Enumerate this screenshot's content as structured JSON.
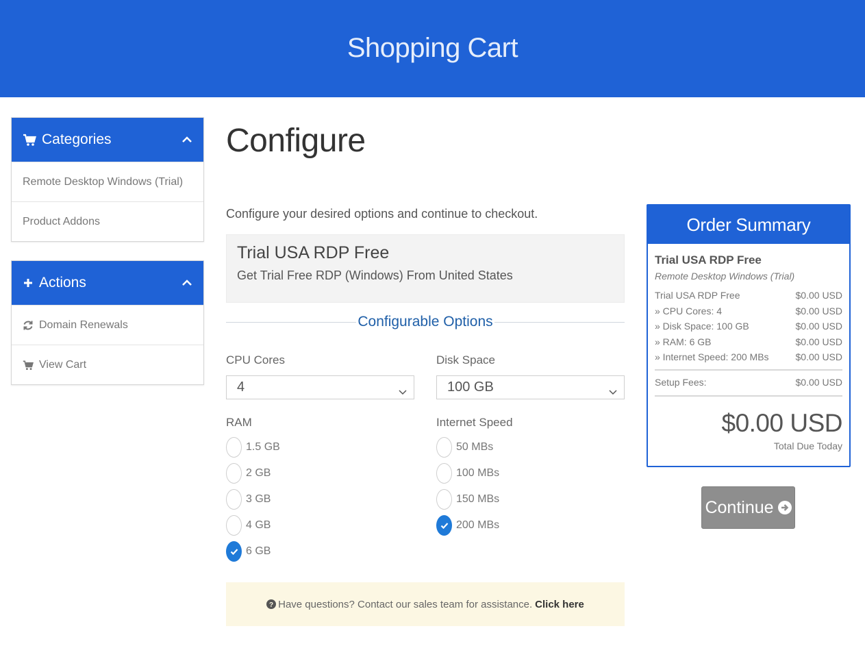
{
  "header": {
    "title": "Shopping Cart"
  },
  "sidebar": {
    "categories": {
      "title": "Categories",
      "items": [
        {
          "label": "Remote Desktop Windows (Trial)"
        },
        {
          "label": "Product Addons"
        }
      ]
    },
    "actions": {
      "title": "Actions",
      "items": [
        {
          "label": "Domain Renewals",
          "icon": "refresh-icon"
        },
        {
          "label": "View Cart",
          "icon": "cart-icon"
        }
      ]
    }
  },
  "main": {
    "title": "Configure",
    "intro": "Configure your desired options and continue to checkout.",
    "product": {
      "name": "Trial USA RDP Free",
      "description": "Get Trial Free RDP (Windows) From United States"
    },
    "options_heading": "Configurable Options",
    "cpu": {
      "label": "CPU Cores",
      "value": "4"
    },
    "disk": {
      "label": "Disk Space",
      "value": "100 GB"
    },
    "ram": {
      "label": "RAM",
      "options": [
        "1.5 GB",
        "2 GB",
        "3 GB",
        "4 GB",
        "6 GB"
      ],
      "selected": "6 GB"
    },
    "speed": {
      "label": "Internet Speed",
      "options": [
        "50 MBs",
        "100 MBs",
        "150 MBs",
        "200 MBs"
      ],
      "selected": "200 MBs"
    },
    "help": {
      "text": "Have questions? Contact our sales team for assistance.",
      "link": "Click here"
    }
  },
  "summary": {
    "title": "Order Summary",
    "product_name": "Trial USA RDP Free",
    "product_group": "Remote Desktop Windows (Trial)",
    "lines": [
      {
        "label": "Trial USA RDP Free",
        "amount": "$0.00 USD"
      },
      {
        "label": "» CPU Cores: 4",
        "amount": "$0.00 USD"
      },
      {
        "label": "» Disk Space: 100 GB",
        "amount": "$0.00 USD"
      },
      {
        "label": "» RAM: 6 GB",
        "amount": "$0.00 USD"
      },
      {
        "label": "» Internet Speed: 200 MBs",
        "amount": "$0.00 USD"
      }
    ],
    "setup_label": "Setup Fees:",
    "setup_amount": "$0.00 USD",
    "total": "$0.00 USD",
    "total_label": "Total Due Today"
  },
  "continue_label": "Continue",
  "colors": {
    "brand": "#1f62d6",
    "checked": "#1f7ad8",
    "help_bg": "#fcf7e3",
    "button": "#8e8e8e"
  }
}
